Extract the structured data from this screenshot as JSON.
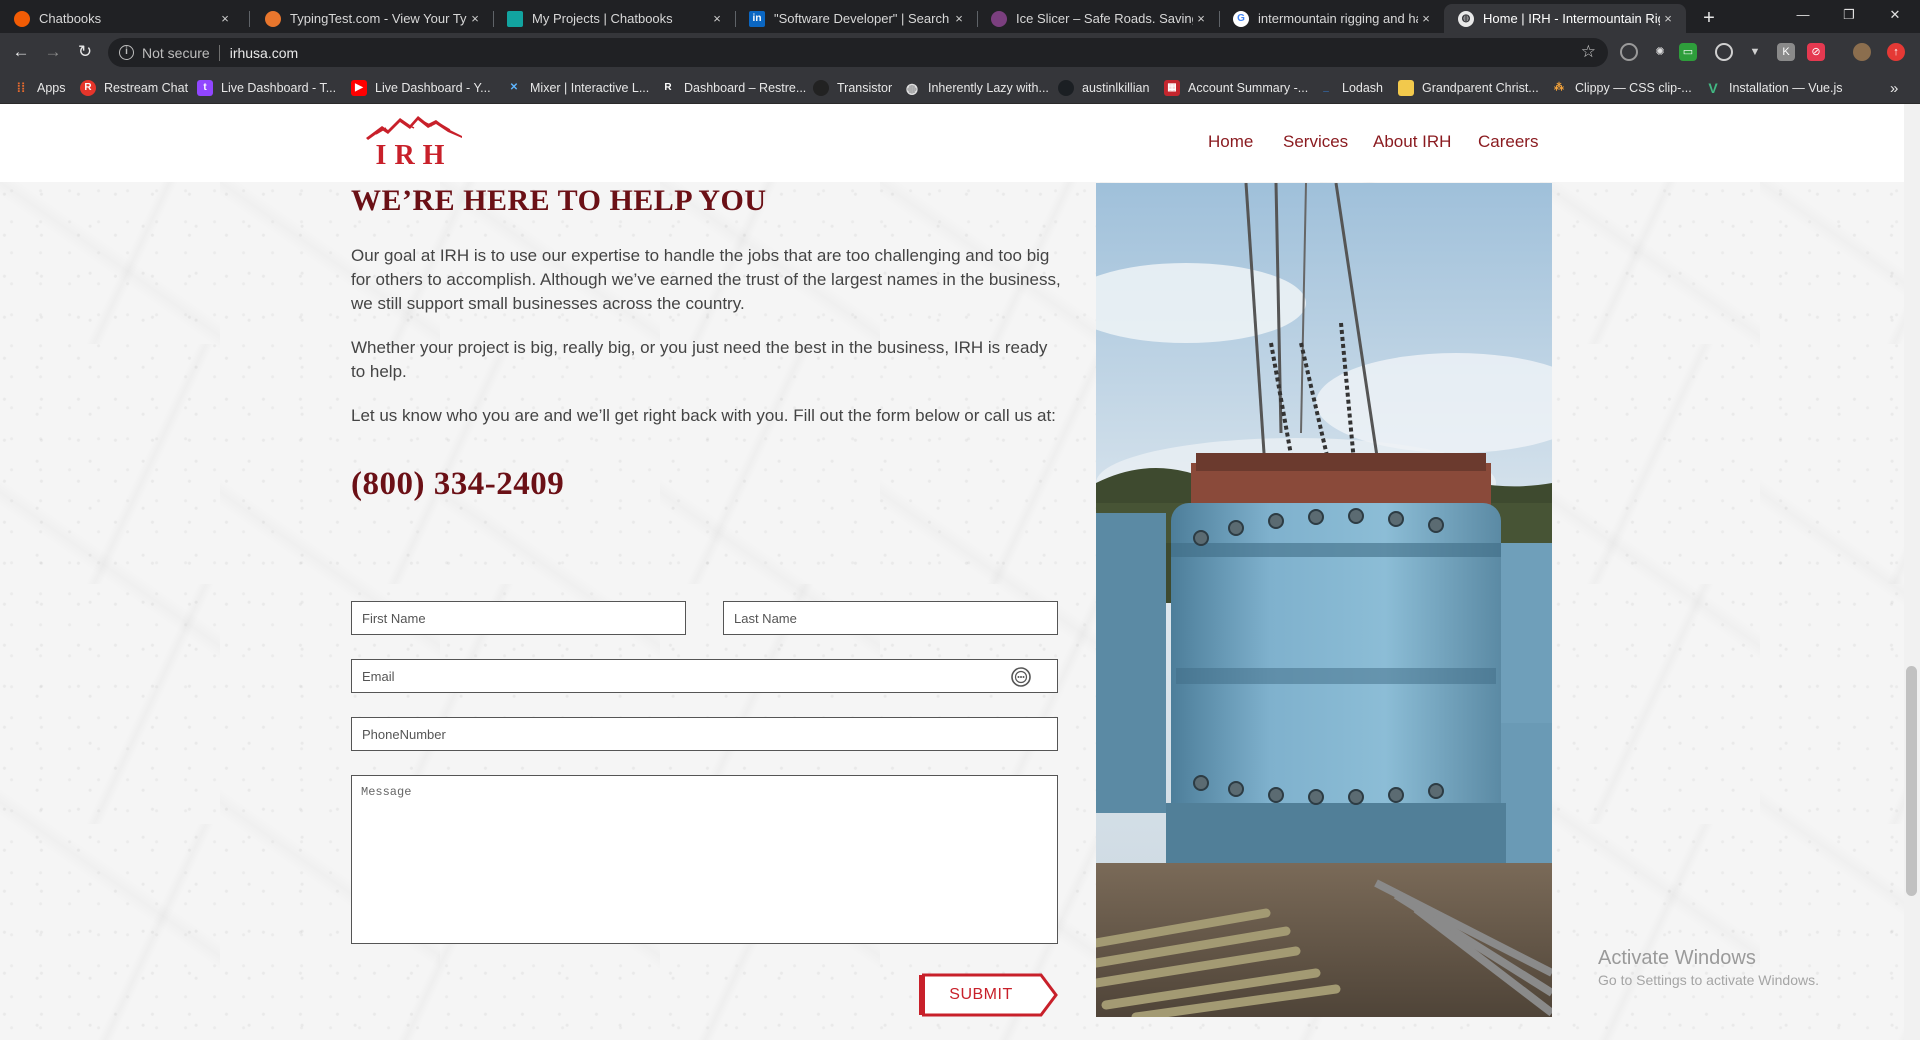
{
  "browser": {
    "tabs": [
      {
        "title": "Chatbooks",
        "favicon": "chatbooks-icon"
      },
      {
        "title": "TypingTest.com - View Your Typin",
        "favicon": "typingtest-icon"
      },
      {
        "title": "My Projects | Chatbooks",
        "favicon": "projects-icon"
      },
      {
        "title": "\"Software Developer\" | Search | L",
        "favicon": "linkedin-icon"
      },
      {
        "title": "Ice Slicer – Safe Roads. Saving Liv",
        "favicon": "iceslicer-icon"
      },
      {
        "title": "intermountain rigging and haulin",
        "favicon": "google-icon"
      },
      {
        "title": "Home | IRH - Intermountain Rigg",
        "favicon": "globe-icon"
      }
    ],
    "close_glyph": "×",
    "new_tab_glyph": "+",
    "window_controls": [
      "—",
      "❐",
      "✕"
    ],
    "address": {
      "security_label": "Not secure",
      "url": "irhusa.com"
    },
    "bookmarks": [
      {
        "label": "Apps",
        "icon": "apps-grid-icon"
      },
      {
        "label": "Restream Chat",
        "icon": "restream-icon"
      },
      {
        "label": "Live Dashboard - T...",
        "icon": "twitch-icon"
      },
      {
        "label": "Live Dashboard - Y...",
        "icon": "youtube-icon"
      },
      {
        "label": "Mixer | Interactive L...",
        "icon": "mixer-icon"
      },
      {
        "label": "Dashboard – Restre...",
        "icon": "restream-r-icon"
      },
      {
        "label": "Transistor",
        "icon": "transistor-icon"
      },
      {
        "label": "Inherently Lazy with...",
        "icon": "globe-icon"
      },
      {
        "label": "austinlkillian",
        "icon": "github-icon"
      },
      {
        "label": "Account Summary -...",
        "icon": "account-icon"
      },
      {
        "label": "Lodash",
        "icon": "lodash-icon"
      },
      {
        "label": "Grandparent Christ...",
        "icon": "bookmark-icon"
      },
      {
        "label": "Clippy — CSS clip-...",
        "icon": "clippy-icon"
      },
      {
        "label": "Installation — Vue.js",
        "icon": "vue-icon"
      }
    ],
    "more_bookmarks": "»"
  },
  "site": {
    "logo_text": "IRH",
    "nav": [
      "Home",
      "Services",
      "About IRH",
      "Careers"
    ],
    "heading": "WE’RE HERE TO HELP YOU",
    "paragraphs": [
      "Our goal at IRH is to use our expertise to handle the jobs that are too challenging and too big for others to accomplish. Although we’ve earned the trust of the largest names in the business, we still support small businesses across the country.",
      "Whether your project is big, really big, or you just need the best in the business, IRH is ready to help.",
      "Let us know who you are and we’ll get right back with you. Fill out the form below or call us at:"
    ],
    "phone": "(800) 334-2409",
    "form": {
      "first_name": "First Name",
      "last_name": "Last Name",
      "email": "Email",
      "phone": "PhoneNumber",
      "message": "Message",
      "submit": "SUBMIT"
    },
    "colors": {
      "brand_red": "#c8202a",
      "heading_maroon": "#6b1016",
      "nav": "#8a1a1f"
    }
  },
  "os": {
    "watermark_title": "Activate Windows",
    "watermark_sub": "Go to Settings to activate Windows."
  }
}
